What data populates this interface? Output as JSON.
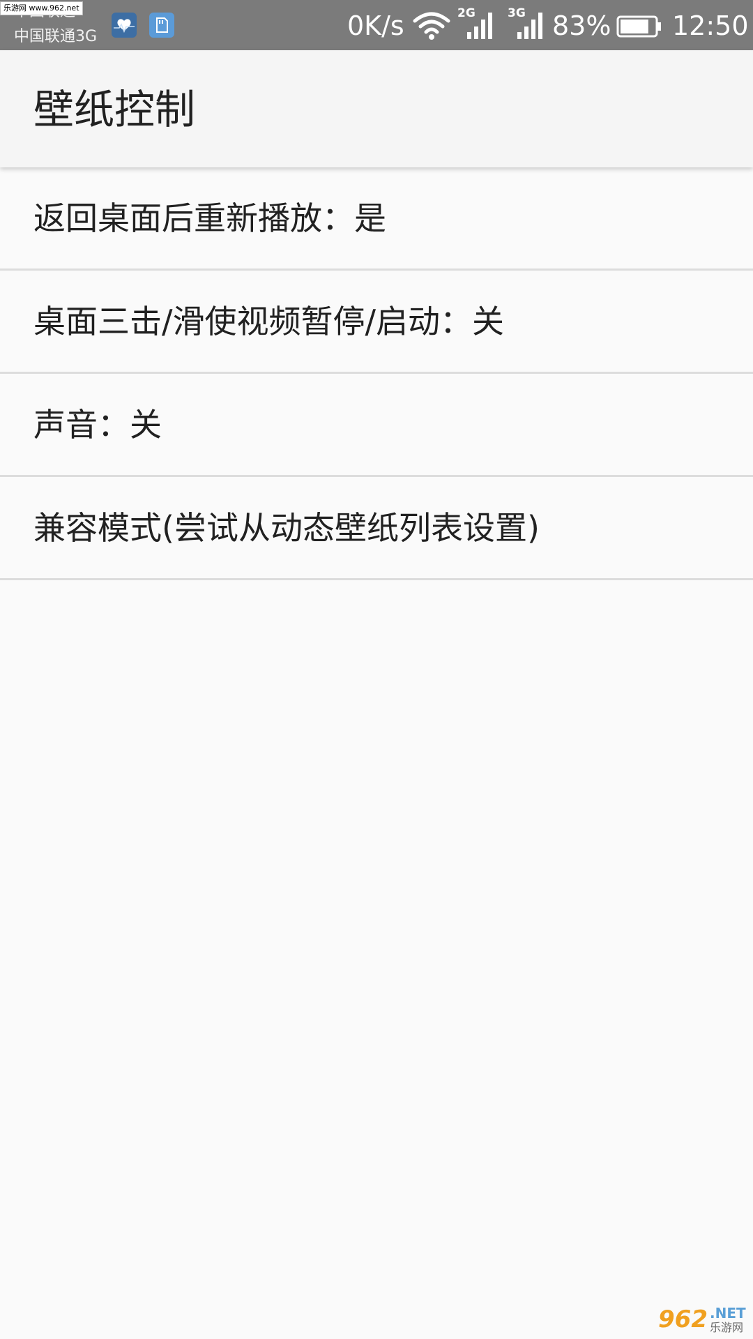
{
  "status_bar": {
    "watermark": "乐游网 www.962.net",
    "carrier_1": "中国联通",
    "carrier_2": "中国联通3G",
    "net_speed": "0K/s",
    "sim1_type": "2G",
    "sim2_type": "3G",
    "battery_percent": "83%",
    "battery_level": 0.83,
    "time": "12:50",
    "notification_icons": [
      "health-app-icon",
      "sd-card-icon"
    ]
  },
  "app_bar": {
    "title": "壁纸控制"
  },
  "settings": {
    "items": [
      {
        "label": "返回桌面后重新播放：是"
      },
      {
        "label": "桌面三击/滑使视频暂停/启动：关"
      },
      {
        "label": "声音：关"
      },
      {
        "label": "兼容模式(尝试从动态壁纸列表设置)"
      }
    ]
  },
  "watermark_bottom": {
    "big": "962",
    "net": ".NET",
    "small": "乐游网"
  },
  "colors": {
    "status_bar_bg": "#7b7b7b",
    "app_bar_bg": "#f5f5f5",
    "page_bg": "#fafafa",
    "divider": "#dcdcdc",
    "text_primary": "#212121"
  }
}
